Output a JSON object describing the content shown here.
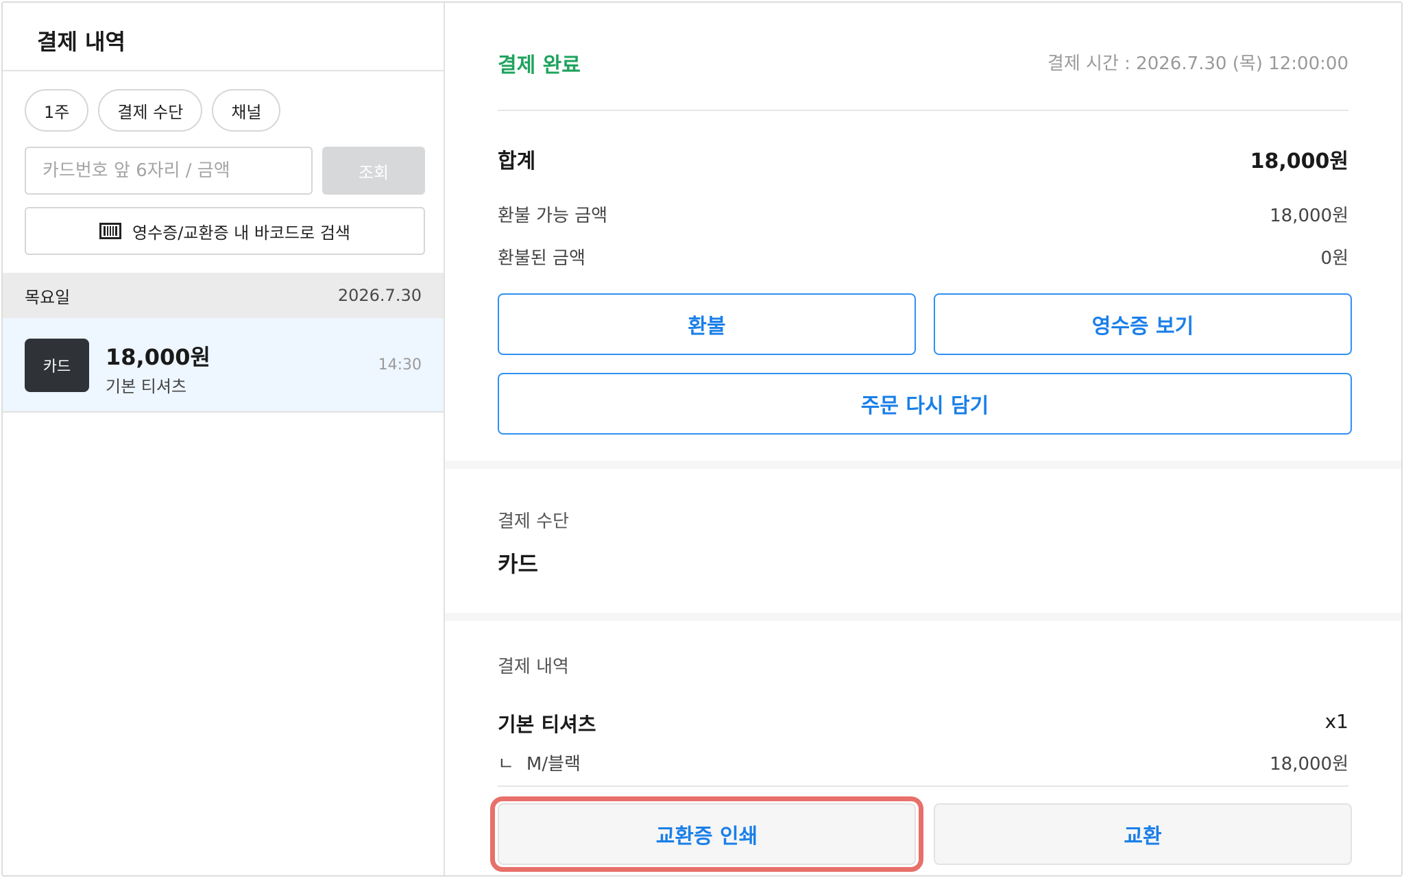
{
  "left": {
    "title": "결제 내역",
    "filters": [
      "1주",
      "결제 수단",
      "채널"
    ],
    "search": {
      "placeholder": "카드번호 앞 6자리 / 금액",
      "button": "조회"
    },
    "barcode_button": "영수증/교환증 내 바코드로 검색",
    "group": {
      "weekday": "목요일",
      "date": "2026.7.30"
    },
    "transaction": {
      "method": "카드",
      "amount": "18,000원",
      "item": "기본 티셔츠",
      "time": "14:30"
    }
  },
  "detail": {
    "status": "결제 완료",
    "paid_time": "결제 시간 : 2026.7.30 (목) 12:00:00",
    "total_label": "합계",
    "total_value": "18,000원",
    "refundable_label": "환불 가능 금액",
    "refundable_value": "18,000원",
    "refunded_label": "환불된 금액",
    "refunded_value": "0원",
    "buttons": {
      "refund": "환불",
      "receipt": "영수증 보기",
      "reorder": "주문 다시 담기"
    },
    "payment_method_label": "결제 수단",
    "payment_method_value": "카드",
    "history_label": "결제 내역",
    "item": {
      "name": "기본 티셔츠",
      "qty": "x1",
      "option_prefix": "ㄴ",
      "option": "M/블랙",
      "price": "18,000원"
    },
    "bottom_buttons": {
      "print_exchange": "교환증 인쇄",
      "exchange": "교환"
    }
  },
  "colors": {
    "status_green": "#1ea35e",
    "accent_blue": "#1a7fe8",
    "highlight_red": "#e8706a"
  }
}
